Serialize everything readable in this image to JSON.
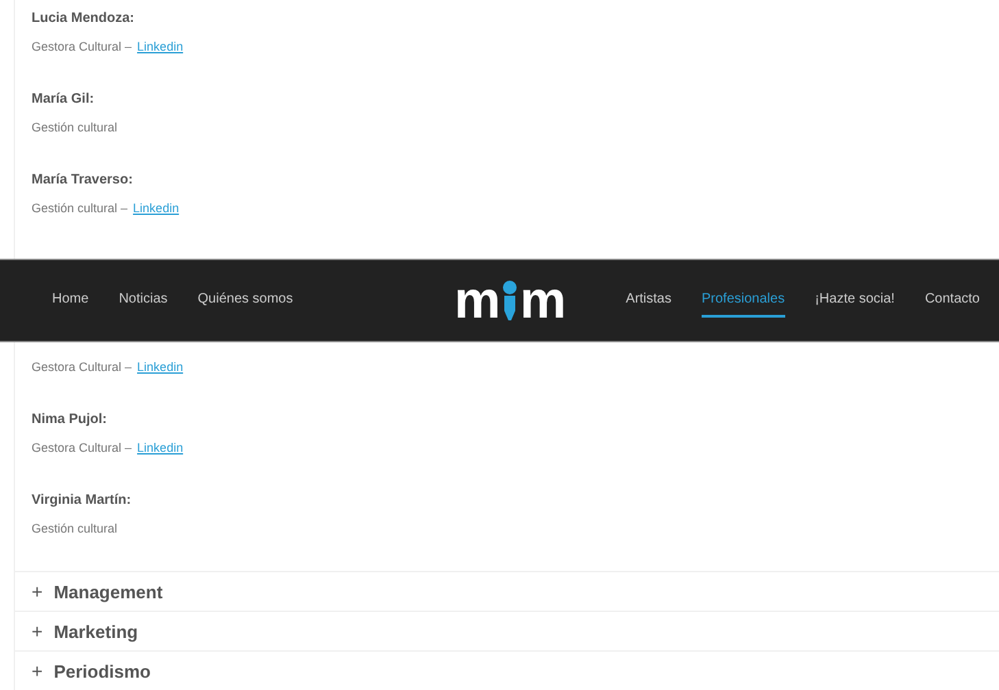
{
  "people_before": [
    {
      "name": "Lucia Mendoza:",
      "role": "Gestora Cultural –",
      "link": "Linkedin"
    },
    {
      "name": "María Gil:",
      "role": "Gestión cultural"
    },
    {
      "name": "María Traverso:",
      "role": "Gestión cultural –",
      "link": "Linkedin"
    }
  ],
  "header": {
    "nav_left": [
      {
        "label": "Home",
        "selected": false
      },
      {
        "label": "Noticias",
        "selected": false
      },
      {
        "label": "Quiénes somos",
        "selected": false
      }
    ],
    "logo": {
      "left": "m",
      "right": "m"
    },
    "nav_right": [
      {
        "label": "Artistas",
        "selected": false
      },
      {
        "label": "Profesionales",
        "selected": true
      },
      {
        "label": "¡Hazte socia!",
        "selected": false
      },
      {
        "label": "Contacto",
        "selected": false
      }
    ]
  },
  "people_after": [
    {
      "role": "Gestora Cultural –",
      "link": "Linkedin"
    },
    {
      "name": "Nima Pujol:",
      "role": "Gestora Cultural –",
      "link": "Linkedin"
    },
    {
      "name": "Virginia Martín:",
      "role": "Gestión cultural"
    }
  ],
  "sections": [
    {
      "icon": "+",
      "label": "Management"
    },
    {
      "icon": "+",
      "label": "Marketing"
    },
    {
      "icon": "+",
      "label": "Periodismo"
    }
  ]
}
